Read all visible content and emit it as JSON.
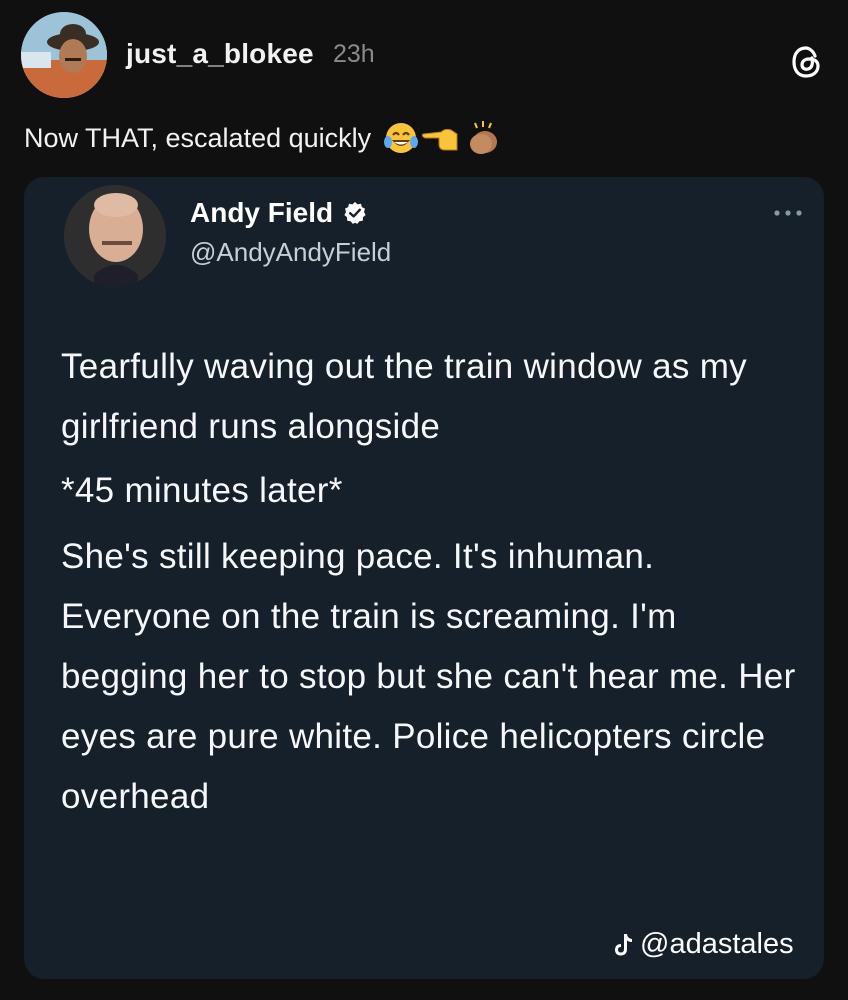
{
  "post": {
    "username": "just_a_blokee",
    "time": "23h",
    "icon": "threads-logo-icon",
    "caption": "Now THAT, escalated quickly",
    "caption_emojis": [
      "😂",
      "👈",
      "👏"
    ]
  },
  "tweet": {
    "name": "Andy Field",
    "verified_icon": "verified-badge-icon",
    "handle": "@AndyAndyField",
    "more_icon": "more-options-icon",
    "paragraphs": [
      "Tearfully waving out the train window as my girlfriend runs alongside",
      "*45 minutes later*",
      "She's still keeping pace. It's inhuman. Everyone on the train is screaming. I'm begging her to stop but she can't hear me. Her eyes are pure white. Police helicopters circle overhead"
    ],
    "watermark": "@adastales",
    "watermark_icon": "tiktok-icon"
  },
  "colors": {
    "page_background": "#101010",
    "card_background": "#15202b",
    "timestamp": "#8a8a8a"
  }
}
